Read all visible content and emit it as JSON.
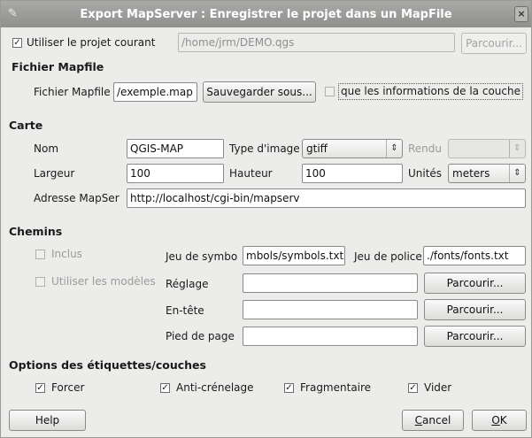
{
  "window": {
    "title": "Export MapServer : Enregistrer le projet dans un MapFile",
    "close_glyph": "×"
  },
  "project": {
    "use_current_label": "Utiliser le projet courant",
    "use_current_checked": true,
    "path": "/home/jrm/DEMO.qgs",
    "browse_label": "Parcourir..."
  },
  "mapfile": {
    "section_title": "Fichier Mapfile",
    "label": "Fichier Mapfile",
    "value": "/exemple.map",
    "save_as_label": "Sauvegarder sous...",
    "layer_info_only_label": "que les informations de la couche",
    "layer_info_only_checked": false
  },
  "carte": {
    "section_title": "Carte",
    "name_label": "Nom",
    "name_value": "QGIS-MAP",
    "image_type_label": "Type d'image",
    "image_type_value": "gtiff",
    "render_label": "Rendu",
    "render_value": "",
    "width_label": "Largeur",
    "width_value": "100",
    "height_label": "Hauteur",
    "height_value": "100",
    "units_label": "Unités",
    "units_value": "meters",
    "url_label": "Adresse MapSer",
    "url_value": "http://localhost/cgi-bin/mapserv"
  },
  "chemins": {
    "section_title": "Chemins",
    "include_label": "Inclus",
    "include_checked": false,
    "use_templates_label": "Utiliser les modèles",
    "use_templates_checked": false,
    "symbols_label": "Jeu de symbo",
    "symbols_value": "mbols/symbols.txt",
    "fonts_label": "Jeu de police",
    "fonts_value": "./fonts/fonts.txt",
    "template_label": "Réglage",
    "template_value": "",
    "header_label": "En-tête",
    "header_value": "",
    "footer_label": "Pied de page",
    "footer_value": "",
    "browse_label": "Parcourir..."
  },
  "options": {
    "section_title": "Options des étiquettes/couches",
    "force_label": "Forcer",
    "force_checked": true,
    "antialias_label": "Anti-crénelage",
    "antialias_checked": true,
    "partial_label": "Fragmentaire",
    "partial_checked": true,
    "buffer_label": "Vider",
    "buffer_checked": true
  },
  "footer": {
    "help_label": "Help",
    "cancel_label": "Cancel",
    "ok_label": "OK"
  },
  "glyphs": {
    "check": "✓",
    "updown": "⇕"
  }
}
